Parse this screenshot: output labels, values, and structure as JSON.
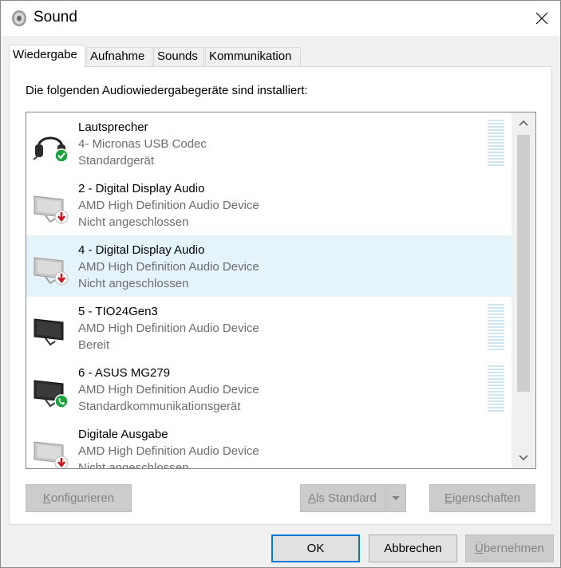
{
  "window": {
    "title": "Sound"
  },
  "tabs": [
    {
      "label": "Wiedergabe",
      "active": true
    },
    {
      "label": "Aufnahme",
      "active": false
    },
    {
      "label": "Sounds",
      "active": false
    },
    {
      "label": "Kommunikation",
      "active": false
    }
  ],
  "panel": {
    "caption": "Die folgenden Audiowiedergabegeräte sind installiert:"
  },
  "devices": [
    {
      "name": "Lautsprecher",
      "description": "4- Micronas USB Codec",
      "status": "Standardgerät",
      "icon": "headset-icon",
      "badge": "default-check-badge",
      "selected": false,
      "level_meter": true
    },
    {
      "name": "2 - Digital Display Audio",
      "description": "AMD High Definition Audio Device",
      "status": "Nicht angeschlossen",
      "icon": "monitor-icon",
      "badge": "disconnected-arrow-badge",
      "selected": false,
      "level_meter": false
    },
    {
      "name": "4 - Digital Display Audio",
      "description": "AMD High Definition Audio Device",
      "status": "Nicht angeschlossen",
      "icon": "monitor-icon",
      "badge": "disconnected-arrow-badge",
      "selected": true,
      "level_meter": false
    },
    {
      "name": "5 - TIO24Gen3",
      "description": "AMD High Definition Audio Device",
      "status": "Bereit",
      "icon": "monitor-icon",
      "badge": "",
      "selected": false,
      "level_meter": true
    },
    {
      "name": "6 - ASUS MG279",
      "description": "AMD High Definition Audio Device",
      "status": "Standardkommunikationsgerät",
      "icon": "monitor-icon",
      "badge": "communication-phone-badge",
      "selected": false,
      "level_meter": true
    },
    {
      "name": "Digitale Ausgabe",
      "description": "AMD High Definition Audio Device",
      "status": "Nicht angeschlossen",
      "icon": "monitor-icon",
      "badge": "disconnected-arrow-badge",
      "selected": false,
      "level_meter": false
    }
  ],
  "buttons": {
    "configure": {
      "mnemonic": "K",
      "rest": "onfigurieren"
    },
    "set_default": {
      "mnemonic": "A",
      "rest": "ls Standard"
    },
    "properties": {
      "mnemonic": "E",
      "rest": "igenschaften"
    },
    "ok": "OK",
    "cancel": "Abbrechen",
    "apply": {
      "mnemonic": "Ü",
      "rest": "bernehmen"
    }
  },
  "colors": {
    "selection": "#e5f3fb",
    "check_green": "#1aa33a",
    "arrow_red": "#d0161d",
    "focus_blue": "#0078d7"
  }
}
